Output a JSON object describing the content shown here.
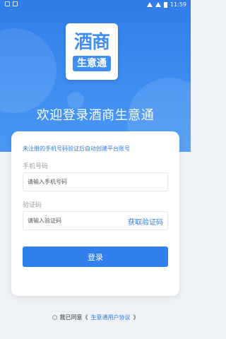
{
  "status": {
    "time": "11:59"
  },
  "logo": {
    "top_text": "酒商",
    "bottom_text": "生意通"
  },
  "welcome": "欢迎登录酒商生意通",
  "card": {
    "hint": "未注册的手机号码验证后自动创建平台账号",
    "phone_label": "手机号码",
    "phone_placeholder": "请输入手机号码",
    "code_label": "验证码",
    "code_placeholder": "请输入验证码",
    "get_code": "获取验证码",
    "login": "登录"
  },
  "agreement": {
    "prefix": "我已同意《",
    "link": "生意通用户协议",
    "suffix": "》"
  },
  "colors": {
    "primary": "#2f7ce8",
    "hero_gradient": "#3f8ef1",
    "background": "#eef1f5"
  }
}
